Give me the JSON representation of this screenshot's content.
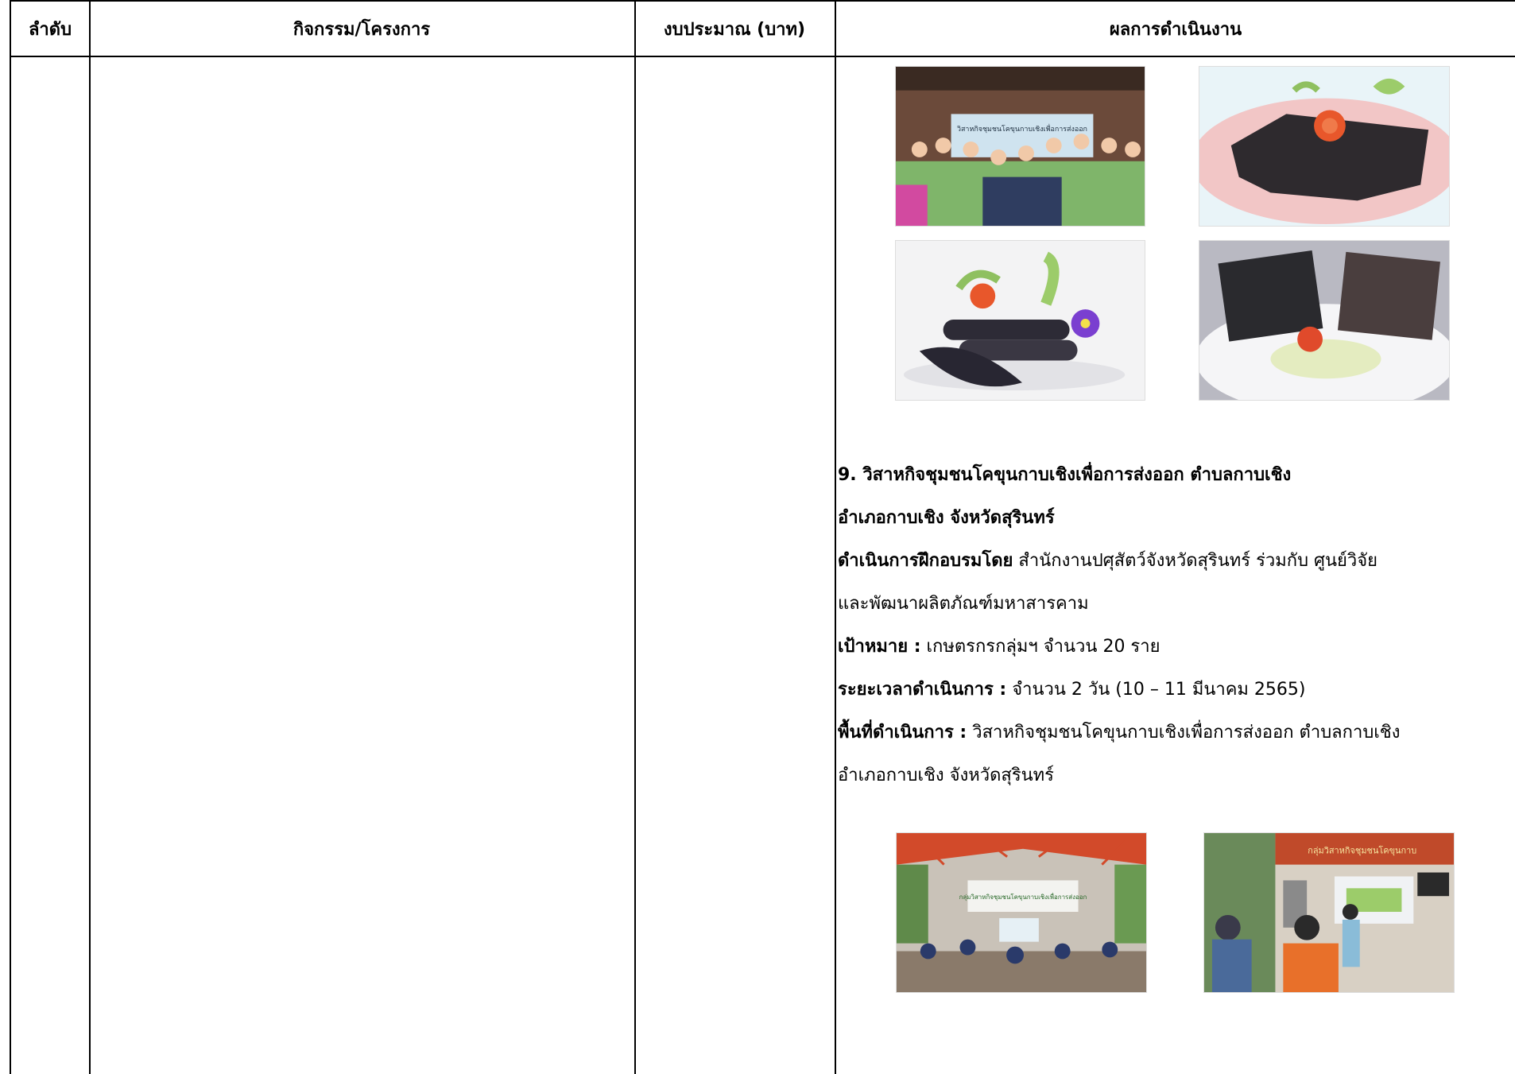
{
  "table": {
    "headers": [
      "ลำดับ",
      "กิจกรรม/โครงการ",
      "งบประมาณ (บาท)",
      "ผลการดำเนินงาน"
    ]
  },
  "result": {
    "heading_line1": "9. วิสาหกิจชุมชนโคขุนกาบเชิงเพื่อการส่งออก ตำบลกาบเชิง",
    "heading_line2": "อำเภอกาบเชิง จังหวัดสุรินทร์",
    "training_label": "ดำเนินการฝึกอบรมโดย",
    "training_value": " สำนักงานปศุสัตว์จังหวัดสุรินทร์ ร่วมกับ ศูนย์วิจัย",
    "training_value_cont": "และพัฒนาผลิตภัณฑ์มหาสารคาม",
    "target_label": "เป้าหมาย :",
    "target_value": " เกษตรกรกลุ่มฯ จำนวน 20 ราย",
    "duration_label": "ระยะเวลาดำเนินการ :",
    "duration_value": " จำนวน 2 วัน (10 – 11 มีนาคม 2565)",
    "area_label": "พื้นที่ดำเนินการ :",
    "area_value": " วิสาหกิจชุมชนโคขุนกาบเชิงเพื่อการส่งออก ตำบลกาบเชิง",
    "area_value_cont": "อำเภอกาบเชิง จังหวัดสุรินทร์"
  },
  "photos": {
    "group_photo_banner": "วิสาหกิจชุมชนโคขุนกาบเชิงเพื่อการส่งออก",
    "hall_banner": "กลุ่มวิสาหกิจชุมชนโคขุนกาบเชิงเพื่อการส่งออก",
    "room_banner": "กลุ่มวิสาหกิจชุมชนโคขุนกาบ"
  }
}
